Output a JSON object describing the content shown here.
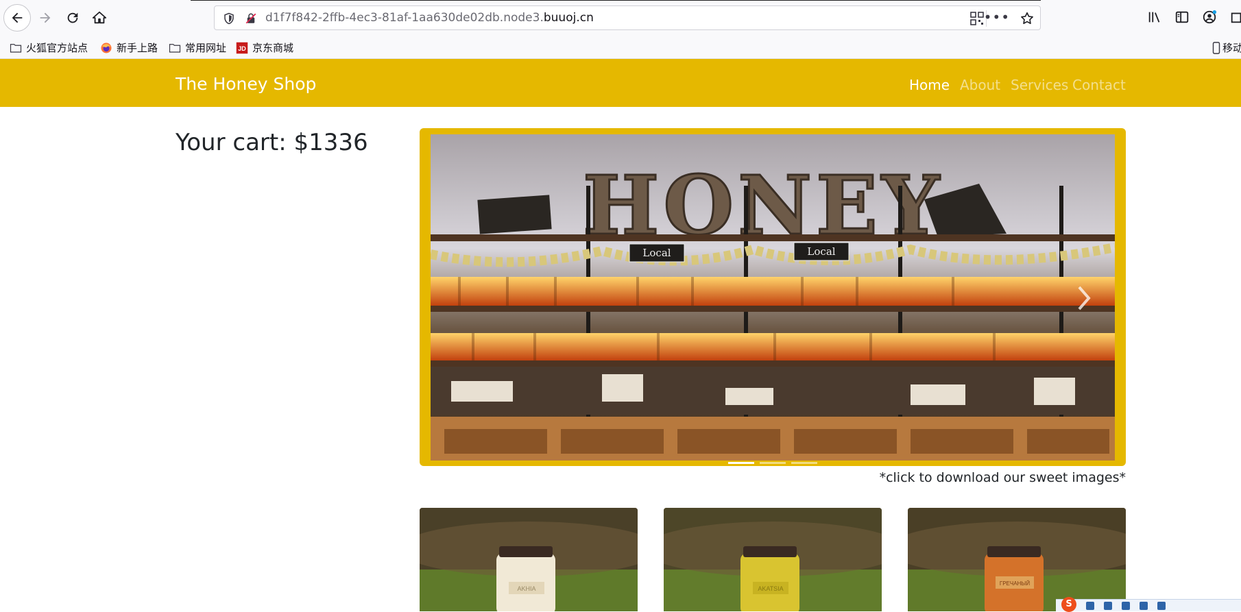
{
  "browser": {
    "url_prefix": "d1f7f842-2ffb-4ec3-81af-1aa630de02db.node3.",
    "url_domain": "buuoj.cn",
    "more_label": "•••"
  },
  "bookmarks": [
    {
      "label": "火狐官方站点",
      "icon": "folder-icon"
    },
    {
      "label": "新手上路",
      "icon": "firefox-icon"
    },
    {
      "label": "常用网址",
      "icon": "folder-icon"
    },
    {
      "label": "京东商城",
      "icon": "jd-icon"
    }
  ],
  "bookmarks_mobile": "移动",
  "jd_badge": "JD",
  "site": {
    "brand": "The Honey Shop",
    "nav": [
      {
        "label": "Home",
        "active": true
      },
      {
        "label": "About",
        "active": false
      },
      {
        "label": "Services",
        "active": false
      },
      {
        "label": "Contact",
        "active": false
      }
    ],
    "cart": "Your cart: $1336",
    "caption": "*click to download our sweet images*",
    "carousel_sign": "HONEY",
    "carousel_labels": [
      "Local",
      "Local"
    ],
    "carousel_indicators": 3,
    "carousel_active_index": 0,
    "products": [
      {
        "jar_color": "#f1e9d6",
        "jar_label": "AKHIA"
      },
      {
        "jar_color": "#d9c430",
        "jar_label": "AKATSIA"
      },
      {
        "jar_color": "#d4722a",
        "jar_label": "ГРЕЧАНЫЙ"
      }
    ]
  },
  "colors": {
    "accent": "#e5b800",
    "text": "#212529"
  },
  "ime": {
    "logo": "S"
  }
}
